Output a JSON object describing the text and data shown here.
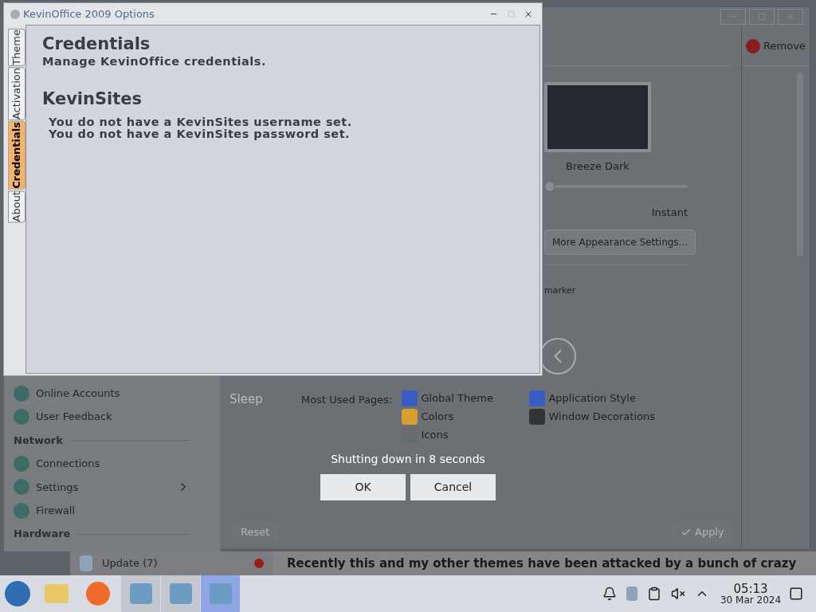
{
  "dialog": {
    "title": "KevinOffice 2009 Options",
    "tabs": [
      {
        "label": "Theme",
        "selected": false
      },
      {
        "label": "Activation",
        "selected": false
      },
      {
        "label": "Credentials",
        "selected": true
      },
      {
        "label": "About",
        "selected": false
      }
    ],
    "heading": "Credentials",
    "subtitle": "Manage KevinOffice credentials.",
    "section": "KevinSites",
    "messages": [
      "You do not have a KevinSites username set.",
      "You do not have a KevinSites password set."
    ]
  },
  "settings_window": {
    "remove_button": "Remove",
    "theme": {
      "name": "Breeze Dark"
    },
    "slider": {
      "level": 0,
      "label": "Instant"
    },
    "more_button": "More Appearance Settings...",
    "fragment": "marker",
    "most_used": {
      "label": "Most Used Pages:",
      "pages": [
        "Global Theme",
        "Colors",
        "Icons",
        "Application Style",
        "Window Decorations"
      ]
    },
    "reset_button": "Reset",
    "apply_button": "Apply"
  },
  "menu": {
    "items": [
      {
        "kind": "item",
        "label": "Online Accounts"
      },
      {
        "kind": "item",
        "label": "User Feedback"
      },
      {
        "kind": "header",
        "label": "Network"
      },
      {
        "kind": "item",
        "label": "Connections"
      },
      {
        "kind": "submenu",
        "label": "Settings"
      },
      {
        "kind": "item",
        "label": "Firewall"
      },
      {
        "kind": "header",
        "label": "Hardware"
      }
    ]
  },
  "power": {
    "sleep": "Sleep"
  },
  "shutdown": {
    "message": "Shutting down in 8 seconds",
    "buttons": [
      "OK",
      "Cancel"
    ]
  },
  "webpage": {
    "update": "Update (7)",
    "text": "Recently this and my other themes have been attacked by a bunch of crazy"
  },
  "taskbar": {
    "tasks": [
      {
        "selected": false
      },
      {
        "selected": false
      },
      {
        "selected": true
      }
    ],
    "time": "05:13",
    "date": "30 Mar 2024"
  }
}
